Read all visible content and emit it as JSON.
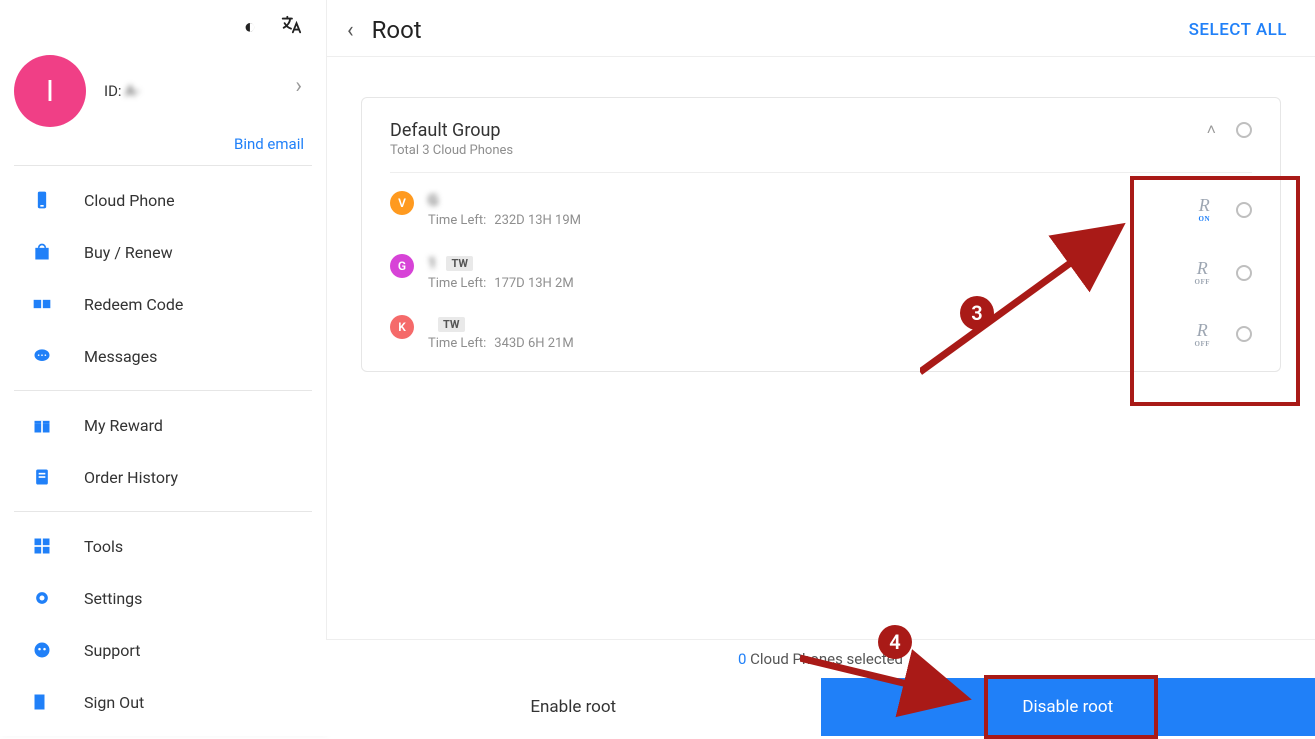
{
  "user": {
    "initial": "I",
    "id_prefix": "ID:",
    "id_value_masked": "  A-"
  },
  "links": {
    "bind_email": "Bind email"
  },
  "nav": {
    "items": [
      {
        "label": "Cloud Phone"
      },
      {
        "label": "Buy / Renew"
      },
      {
        "label": "Redeem Code"
      },
      {
        "label": "Messages"
      },
      {
        "label": "My Reward"
      },
      {
        "label": "Order History"
      },
      {
        "label": "Tools"
      },
      {
        "label": "Settings"
      },
      {
        "label": "Support"
      },
      {
        "label": "Sign Out"
      }
    ]
  },
  "page": {
    "title": "Root",
    "select_all": "SELECT ALL",
    "selected_count": "0",
    "selected_suffix": " Cloud Phones selected",
    "enable_btn": "Enable root",
    "disable_btn": "Disable root"
  },
  "group": {
    "title": "Default Group",
    "subtitle": "Total 3 Cloud Phones"
  },
  "phones": [
    {
      "badge": "V",
      "name_masked": "      G",
      "tag": "",
      "time_label": "Time Left:",
      "time": "232D  13H  19M",
      "root": "ON"
    },
    {
      "badge": "G",
      "name_masked": "    1",
      "tag": "TW",
      "time_label": "Time Left:",
      "time": "177D  13H  2M",
      "root": "OFF"
    },
    {
      "badge": "K",
      "name_masked": "",
      "tag": "TW",
      "time_label": "Time Left:",
      "time": "343D  6H  21M",
      "root": "OFF"
    }
  ],
  "annotations": {
    "step3": "3",
    "step4": "4"
  }
}
